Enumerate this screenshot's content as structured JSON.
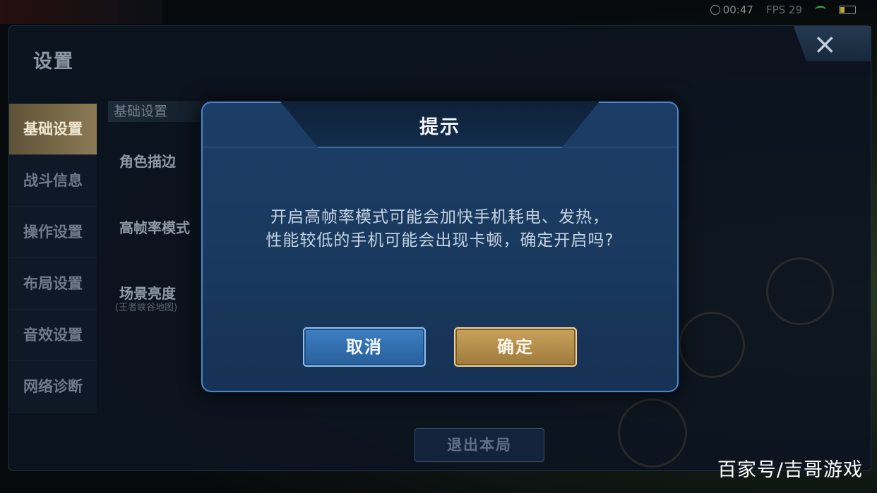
{
  "statusbar": {
    "time": "00:47",
    "fps": "FPS 29"
  },
  "settings": {
    "title": "设置",
    "close_icon": "×",
    "sidebar": [
      {
        "label": "基础设置",
        "active": true
      },
      {
        "label": "战斗信息"
      },
      {
        "label": "操作设置"
      },
      {
        "label": "布局设置"
      },
      {
        "label": "音效设置"
      },
      {
        "label": "网络诊断"
      }
    ],
    "section_header": "基础设置",
    "options": [
      {
        "label": "角色描边"
      },
      {
        "label": "高帧率模式"
      },
      {
        "label": "场景亮度",
        "sublabel": "(王者峡谷地图)"
      }
    ],
    "exit_label": "退出本局"
  },
  "dialog": {
    "title": "提示",
    "message_line1": "开启高帧率模式可能会加快手机耗电、发热，",
    "message_line2": "性能较低的手机可能会出现卡顿，确定开启吗?",
    "cancel_label": "取消",
    "confirm_label": "确定"
  },
  "watermark": "百家号/吉哥游戏",
  "colors": {
    "accent_blue": "#4b84c5",
    "confirm_gold": "#c9a25d",
    "active_tab": "#8c7a54"
  }
}
